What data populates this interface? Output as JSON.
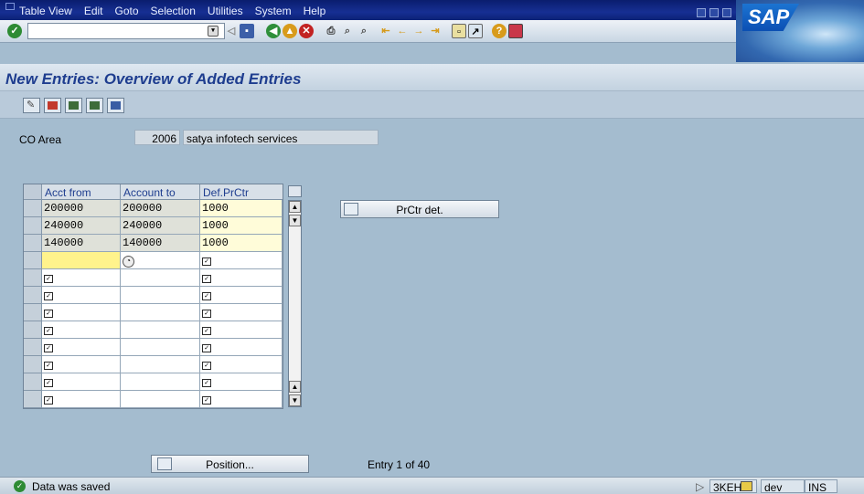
{
  "menu": {
    "items": [
      "Table View",
      "Edit",
      "Goto",
      "Selection",
      "Utilities",
      "System",
      "Help"
    ],
    "logo": "SAP"
  },
  "page": {
    "title": "New Entries: Overview of Added Entries"
  },
  "co_area": {
    "label": "CO Area",
    "value": "2006",
    "description": "satya infotech  services"
  },
  "table": {
    "headers": [
      "Acct from",
      "Account to",
      "Def.PrCtr"
    ],
    "rows": [
      [
        "200000",
        "200000",
        "1000"
      ],
      [
        "240000",
        "240000",
        "1000"
      ],
      [
        "140000",
        "140000",
        "1000"
      ]
    ],
    "empty_rows": 10
  },
  "buttons": {
    "prctr_det": "PrCtr det.",
    "position": "Position..."
  },
  "entry_info": "Entry 1 of 40",
  "status": {
    "message": "Data was saved",
    "system": "3KEH",
    "client": "dev",
    "mode": "INS"
  },
  "icons": [
    "enter-icon",
    "save-icon",
    "back-icon",
    "exit-icon",
    "cancel-icon",
    "print-icon",
    "find-icon",
    "find-next-icon",
    "first-page-icon",
    "previous-page-icon",
    "next-page-icon",
    "last-page-icon",
    "create-session-icon",
    "shortcut-icon",
    "help-icon",
    "layout-icon",
    "display-change-icon",
    "new-entries-icon",
    "copy-as-icon",
    "delete-icon",
    "select-all-icon"
  ]
}
